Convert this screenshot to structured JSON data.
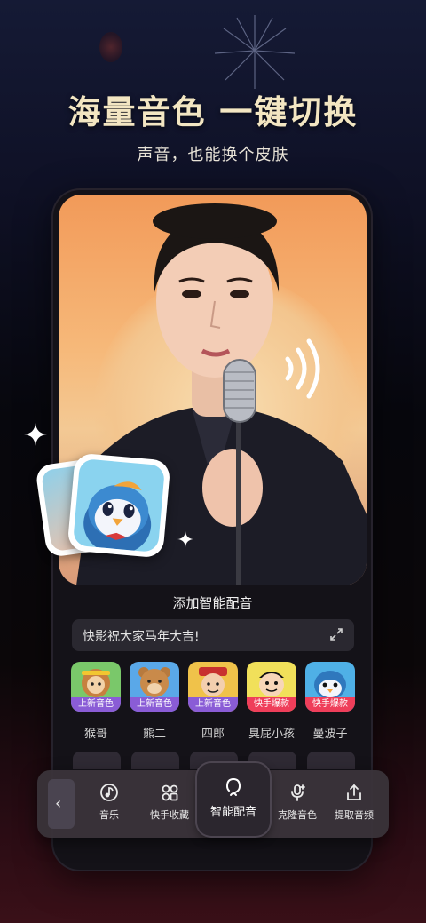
{
  "header": {
    "headline": "海量音色 一键切换",
    "subline": "声音，也能换个皮肤"
  },
  "panel": {
    "title": "添加智能配音",
    "text_value": "快影祝大家马年大吉!"
  },
  "voices": [
    {
      "name": "猴哥",
      "tag": "上新音色",
      "tag_color": "#8a5cd6",
      "bg": "#7ac86a"
    },
    {
      "name": "熊二",
      "tag": "上新音色",
      "tag_color": "#8a5cd6",
      "bg": "#5aa8e8"
    },
    {
      "name": "四郎",
      "tag": "上新音色",
      "tag_color": "#8a5cd6",
      "bg": "#f0c24a"
    },
    {
      "name": "臭屁小孩",
      "tag": "快手爆款",
      "tag_color": "#ef3e5a",
      "bg": "#f1e05a"
    },
    {
      "name": "曼波子",
      "tag": "快手爆款",
      "tag_color": "#ef3e5a",
      "bg": "#4fb0e6"
    }
  ],
  "toolbar": {
    "back_symbol": "‹",
    "items": [
      {
        "label": "音乐",
        "icon": "music-note-icon"
      },
      {
        "label": "快手收藏",
        "icon": "favorites-icon"
      },
      {
        "label": "智能配音",
        "icon": "smart-voice-icon",
        "active": true
      },
      {
        "label": "克隆音色",
        "icon": "clone-voice-icon"
      },
      {
        "label": "提取音频",
        "icon": "extract-audio-icon"
      }
    ]
  }
}
